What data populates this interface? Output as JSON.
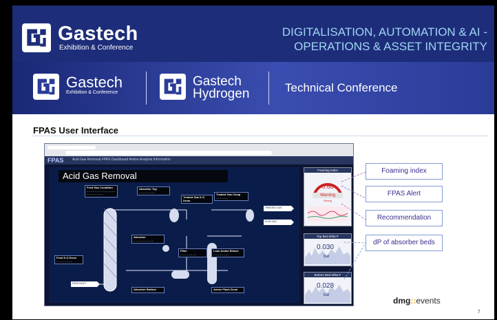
{
  "header": {
    "brand": "Gastech",
    "brand_sub": "Exhibition & Conference",
    "title_line1": "DIGITALISATION, AUTOMATION & AI -",
    "title_line2": "OPERATIONS & ASSET INTEGRITY"
  },
  "band": {
    "brand1": "Gastech",
    "brand1_sub": "Exhibition & Conference",
    "brand2_line1": "Gastech",
    "brand2_line2": "Hydrogen",
    "conference": "Technical Conference"
  },
  "section_title": "FPAS User Interface",
  "screenshot": {
    "app_logo": "FPAS",
    "nav": "Acid Gas Removal   FPAS Dashboard   Amine Analysis   Information",
    "diagram_title": "Acid Gas Removal",
    "labels": {
      "feed_gas": "Feed Gas Condition",
      "absorber_top": "Absorber Top",
      "treated_gas_ko": "Treated Gas K.O Drum",
      "treated_gas_comp": "Treated Gas Comp",
      "treated_gas": "TREATED GAS",
      "acid_gas": "ACID GAS",
      "absorber": "Absorber",
      "filter": "Filter",
      "lean_amine": "Lean Amine Return",
      "feed_ko": "Feed K.O Drum",
      "feed_inlet": "FEED INLET",
      "absorber_bottom": "Absorber Bottom",
      "amine_flash": "Amine Flash Drum"
    },
    "foaming_index": {
      "title": "Foaming Index",
      "value": "0.68",
      "status": "Warning",
      "sub": "Strong"
    },
    "top_bed": {
      "title": "Top Bed delta P",
      "value": "0.030",
      "unit": "bar"
    },
    "bottom_bed": {
      "title": "Bottom Bed delta P",
      "value": "0.028",
      "unit": "bar"
    }
  },
  "callouts": [
    "Foaming index",
    "FPAS Alert",
    "Recommendation",
    "dP of absorber beds"
  ],
  "footer": {
    "dmg": "dmg",
    "dots": "::",
    "events": "events",
    "page": "7"
  },
  "colors": {
    "navy": "#1d2d7a",
    "title_blue": "#9fd6f2",
    "callout_text": "#3b2c8f"
  }
}
